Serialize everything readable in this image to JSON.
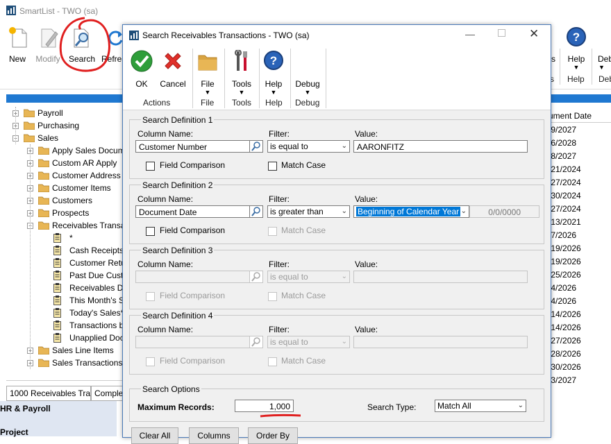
{
  "main_window": {
    "title": "SmartList  -  TWO (sa)",
    "ribbon": {
      "buttons": [
        {
          "label": "New",
          "icon": "new-document-icon"
        },
        {
          "label": "Modify",
          "icon": "modify-document-icon"
        },
        {
          "label": "Search",
          "icon": "search-magnifier-icon"
        },
        {
          "label": "Refres",
          "icon": "refresh-icon"
        }
      ],
      "right_buttons": [
        {
          "label": "s"
        },
        {
          "label": "Help",
          "icon": "help-icon"
        },
        {
          "label": "Deb"
        }
      ],
      "right_group_labels": [
        "s",
        "Help",
        "Deb"
      ]
    },
    "tree": [
      {
        "label": "Payroll",
        "level": 1,
        "kind": "folder",
        "expander": "+"
      },
      {
        "label": "Purchasing",
        "level": 1,
        "kind": "folder",
        "expander": "+"
      },
      {
        "label": "Sales",
        "level": 1,
        "kind": "folder",
        "expander": "-"
      },
      {
        "label": "Apply Sales Docum",
        "level": 2,
        "kind": "folder",
        "expander": "+"
      },
      {
        "label": "Custom AR Apply",
        "level": 2,
        "kind": "folder",
        "expander": "+"
      },
      {
        "label": "Customer Address",
        "level": 2,
        "kind": "folder",
        "expander": "+"
      },
      {
        "label": "Customer Items",
        "level": 2,
        "kind": "folder",
        "expander": "+"
      },
      {
        "label": "Customers",
        "level": 2,
        "kind": "folder",
        "expander": "+"
      },
      {
        "label": "Prospects",
        "level": 2,
        "kind": "folder",
        "expander": "+"
      },
      {
        "label": "Receivables Transa",
        "level": 2,
        "kind": "folder",
        "expander": "-"
      },
      {
        "label": "*",
        "level": 3,
        "kind": "list"
      },
      {
        "label": "Cash Receipts",
        "level": 3,
        "kind": "list"
      },
      {
        "label": "Customer Retu",
        "level": 3,
        "kind": "list"
      },
      {
        "label": "Past Due Custo",
        "level": 3,
        "kind": "list"
      },
      {
        "label": "Receivables Du",
        "level": 3,
        "kind": "list"
      },
      {
        "label": "This Month's S",
        "level": 3,
        "kind": "list"
      },
      {
        "label": "Today's Sales*",
        "level": 3,
        "kind": "list"
      },
      {
        "label": "Transactions b",
        "level": 3,
        "kind": "list"
      },
      {
        "label": "Unapplied Doc",
        "level": 3,
        "kind": "list"
      },
      {
        "label": "Sales Line Items",
        "level": 2,
        "kind": "folder",
        "expander": "+"
      },
      {
        "label": "Sales Transactions",
        "level": 2,
        "kind": "folder",
        "expander": "+"
      }
    ],
    "grid": {
      "column_header": "ument Date",
      "dates": [
        "/9/2027",
        "/6/2028",
        "/8/2027",
        "/21/2024",
        "/27/2024",
        "/30/2024",
        "/27/2024",
        "/13/2021",
        "/7/2026",
        "/19/2026",
        "/19/2026",
        "/25/2026",
        "/4/2026",
        "/4/2026",
        "/14/2026",
        "/14/2026",
        "/27/2026",
        "/28/2026",
        "/30/2026",
        "/3/2027"
      ]
    },
    "bottom_tabs": [
      "1000 Receivables Trar",
      "Complet"
    ],
    "nav_pane": [
      "HR & Payroll",
      "Project"
    ]
  },
  "dialog": {
    "title": "Search Receivables Transactions  -  TWO (sa)",
    "ribbon": {
      "buttons": [
        {
          "label": "OK",
          "icon": "ok-check-icon"
        },
        {
          "label": "Cancel",
          "icon": "cancel-x-icon"
        },
        {
          "label": "File",
          "icon": "folder-icon"
        },
        {
          "label": "Tools",
          "icon": "tools-icon"
        },
        {
          "label": "Help",
          "icon": "help-icon"
        },
        {
          "label": "Debug",
          "icon": ""
        }
      ],
      "groups": [
        "Actions",
        "File",
        "Tools",
        "Help",
        "Debug"
      ]
    },
    "labels": {
      "column_name": "Column Name:",
      "filter": "Filter:",
      "value": "Value:",
      "field_comparison": "Field Comparison",
      "match_case": "Match Case"
    },
    "definitions": [
      {
        "title": "Search Definition 1",
        "column": "Customer Number",
        "filter": "is equal to",
        "value": "AARONFITZ",
        "enabled": true
      },
      {
        "title": "Search Definition 2",
        "column": "Document Date",
        "filter": "is greater than",
        "value": "Beginning of Calendar Year",
        "value_extra": "0/0/0000",
        "enabled": true
      },
      {
        "title": "Search Definition 3",
        "column": "",
        "filter": "is equal to",
        "value": "",
        "enabled": false
      },
      {
        "title": "Search Definition 4",
        "column": "",
        "filter": "is equal to",
        "value": "",
        "enabled": false
      }
    ],
    "search_options": {
      "title": "Search Options",
      "max_records_label": "Maximum Records:",
      "max_records": "1,000",
      "search_type_label": "Search Type:",
      "search_type": "Match All"
    },
    "bottom_buttons": [
      "Clear All",
      "Columns",
      "Order By"
    ],
    "colors": {
      "annotation": "#e02020",
      "accent": "#1f78d1"
    }
  }
}
